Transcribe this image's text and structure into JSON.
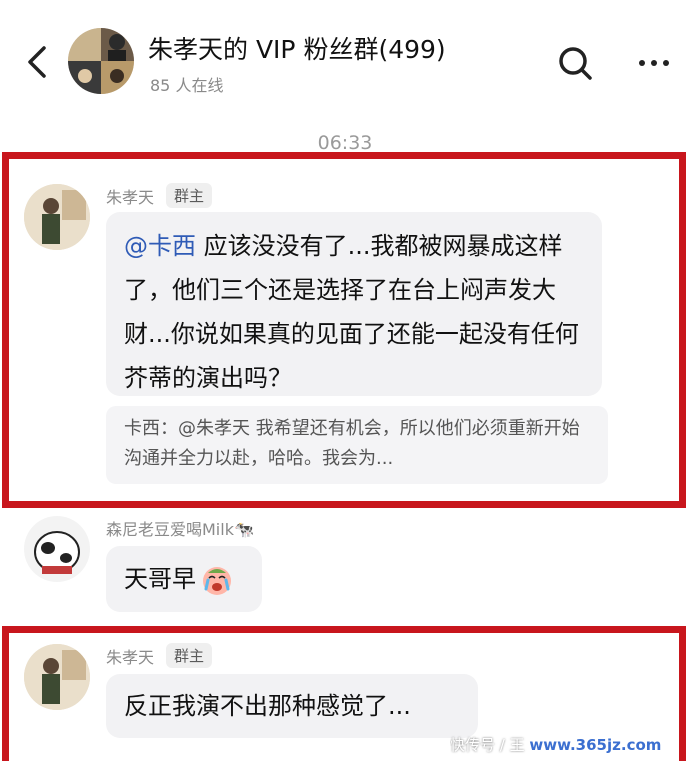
{
  "header": {
    "title": "朱孝天的 VIP 粉丝群(499)",
    "online": "85 人在线"
  },
  "timestamp": "06:33",
  "messages": [
    {
      "sender": "朱孝天",
      "badge": "群主",
      "mention": "@卡西",
      "text": "应该没没有了...我都被网暴成这样了，他们三个还是选择了在台上闷声发大财...你说如果真的见面了还能一起没有任何芥蒂的演出吗？",
      "quote": "卡西：@朱孝天 我希望还有机会，所以他们必须重新开始沟通并全力以赴，哈哈。我会为..."
    },
    {
      "sender": "森尼老豆爱喝Milk🐄",
      "text": "天哥早"
    },
    {
      "sender": "朱孝天",
      "badge": "群主",
      "text": "反正我演不出那种感觉了..."
    }
  ],
  "watermark": {
    "text": "快传号 / 王",
    "site": "www.365jz.com"
  },
  "colors": {
    "highlight": "#c8161d",
    "mention": "#2f5bb6",
    "bubble": "#f2f2f4"
  }
}
